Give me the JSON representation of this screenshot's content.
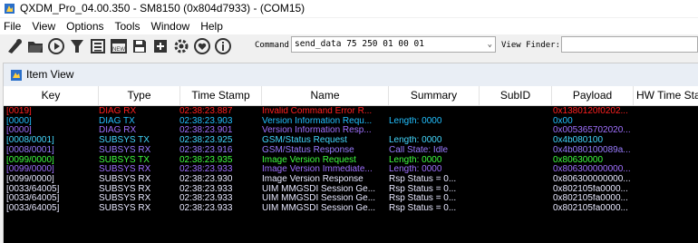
{
  "window": {
    "title": "QXDM_Pro_04.00.350 - SM8150 (0x804d7933) - (COM15)"
  },
  "menu": [
    {
      "label": "File"
    },
    {
      "label": "View"
    },
    {
      "label": "Options"
    },
    {
      "label": "Tools"
    },
    {
      "label": "Window"
    },
    {
      "label": "Help"
    }
  ],
  "toolbar": {
    "icons": [
      "connect-icon",
      "folder-open-icon",
      "play-icon",
      "filter-icon",
      "list-icon",
      "new-window-icon",
      "save-icon",
      "add-icon",
      "settings-icon",
      "heart-icon",
      "info-icon"
    ],
    "command_label": "Command:",
    "command_value": "send_data 75 250 01 00 01",
    "view_finder_label": "View Finder:",
    "view_finder_value": ""
  },
  "item_view": {
    "title": "Item View",
    "columns": [
      "Key",
      "Type",
      "Time Stamp",
      "Name",
      "Summary",
      "SubID",
      "Payload",
      "HW Time Star"
    ],
    "rows": [
      {
        "key": "[0019]",
        "type": "DIAG RX",
        "time": "02:38:23.887",
        "name": "Invalid Command Error R...",
        "summary": "",
        "subid": "",
        "payload": "0x1380120f0202...",
        "color": "#ff2020"
      },
      {
        "key": "[0000]",
        "type": "DIAG TX",
        "time": "02:38:23.903",
        "name": "Version Information Requ...",
        "summary": "Length: 0000",
        "subid": "",
        "payload": "0x00",
        "color": "#22c0ff"
      },
      {
        "key": "[0000]",
        "type": "DIAG RX",
        "time": "02:38:23.901",
        "name": "Version Information Resp...",
        "summary": "",
        "subid": "",
        "payload": "0x005365702020...",
        "color": "#a070ff"
      },
      {
        "key": "[0008/0001]",
        "type": "SUBSYS TX",
        "time": "02:38:23.925",
        "name": "GSM/Status Request",
        "summary": "Length: 0000",
        "subid": "",
        "payload": "0x4b080100",
        "color": "#44d8ff"
      },
      {
        "key": "[0008/0001]",
        "type": "SUBSYS RX",
        "time": "02:38:23.916",
        "name": "GSM/Status Response",
        "summary": "Call State: Idle",
        "subid": "",
        "payload": "0x4b080100089a...",
        "color": "#9a7cff"
      },
      {
        "key": "[0099/0000]",
        "type": "SUBSYS TX",
        "time": "02:38:23.935",
        "name": "Image Version Request",
        "summary": "Length: 0000",
        "subid": "",
        "payload": "0x80630000",
        "color": "#40ff40"
      },
      {
        "key": "[0099/0000]",
        "type": "SUBSYS RX",
        "time": "02:38:23.933",
        "name": "Image Version Immediate...",
        "summary": "Length: 0000",
        "subid": "",
        "payload": "0x806300000000...",
        "color": "#a070ff"
      },
      {
        "key": "[0099/0000]",
        "type": "SUBSYS RX",
        "time": "02:38:23.930",
        "name": "Image Version Response",
        "summary": "Rsp Status = 0...",
        "subid": "",
        "payload": "0x806300000000...",
        "color": "#e8e8ff"
      },
      {
        "key": "[0033/64005]",
        "type": "SUBSYS RX",
        "time": "02:38:23.933",
        "name": "UIM MMGSDI Session Ge...",
        "summary": "Rsp Status = 0...",
        "subid": "",
        "payload": "0x802105fa0000...",
        "color": "#e8e8ff"
      },
      {
        "key": "[0033/64005]",
        "type": "SUBSYS RX",
        "time": "02:38:23.933",
        "name": "UIM MMGSDI Session Ge...",
        "summary": "Rsp Status = 0...",
        "subid": "",
        "payload": "0x802105fa0000...",
        "color": "#e8e8ff"
      },
      {
        "key": "[0033/64005]",
        "type": "SUBSYS RX",
        "time": "02:38:23.933",
        "name": "UIM MMGSDI Session Ge...",
        "summary": "Rsp Status = 0...",
        "subid": "",
        "payload": "0x802105fa0000...",
        "color": "#e8e8ff"
      }
    ]
  },
  "colors": {
    "accent": "#1e6fd0",
    "grid_bg": "#000000"
  }
}
